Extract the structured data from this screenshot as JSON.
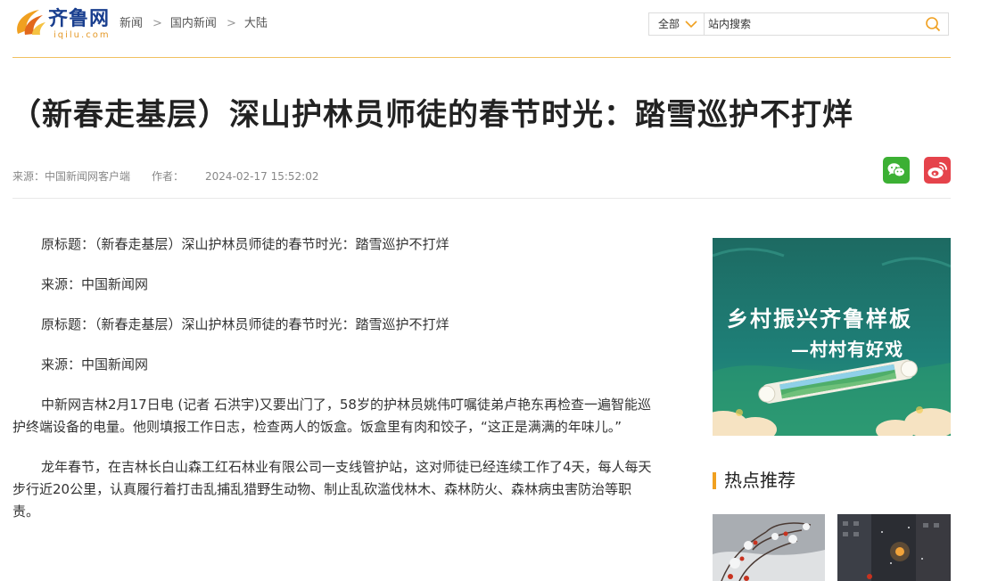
{
  "site": {
    "logo_text": "齐鲁网",
    "logo_domain": "iqilu.com",
    "brand_color": "#1a3f8f",
    "accent_color": "#f0a020"
  },
  "breadcrumb": [
    "新闻",
    "国内新闻",
    "大陆"
  ],
  "breadcrumb_separator": ">",
  "search": {
    "scope": "全部",
    "placeholder": "站内搜索",
    "icon": "search-icon"
  },
  "article": {
    "title": "（新春走基层）深山护林员师徒的春节时光：踏雪巡护不打烊",
    "source": "来源：中国新闻网客户端",
    "author": "作者：",
    "datetime": "2024-02-17 15:52:02",
    "paragraphs": [
      "原标题：（新春走基层）深山护林员师徒的春节时光：踏雪巡护不打烊",
      "来源：中国新闻网",
      "原标题：（新春走基层）深山护林员师徒的春节时光：踏雪巡护不打烊",
      "来源：中国新闻网",
      "中新网吉林2月17日电 (记者 石洪宇)又要出门了，58岁的护林员姚伟叮嘱徒弟卢艳东再检查一遍智能巡护终端设备的电量。他则填报工作日志，检查两人的饭盒。饭盒里有肉和饺子，“这正是满满的年味儿。”",
      "龙年春节，在吉林长白山森工红石林业有限公司一支线管护站，这对师徒已经连续工作了4天，每人每天步行近20公里，认真履行着打击乱捕乱猎野生动物、制止乱砍滥伐林木、森林防火、森林病虫害防治等职责。"
    ]
  },
  "share": {
    "wechat_icon": "wechat-icon",
    "weibo_icon": "weibo-icon"
  },
  "sidebar": {
    "banner": {
      "line1": "乡村振兴齐鲁样板",
      "line2": "—村村有好戏"
    },
    "hot_title": "热点推荐"
  }
}
